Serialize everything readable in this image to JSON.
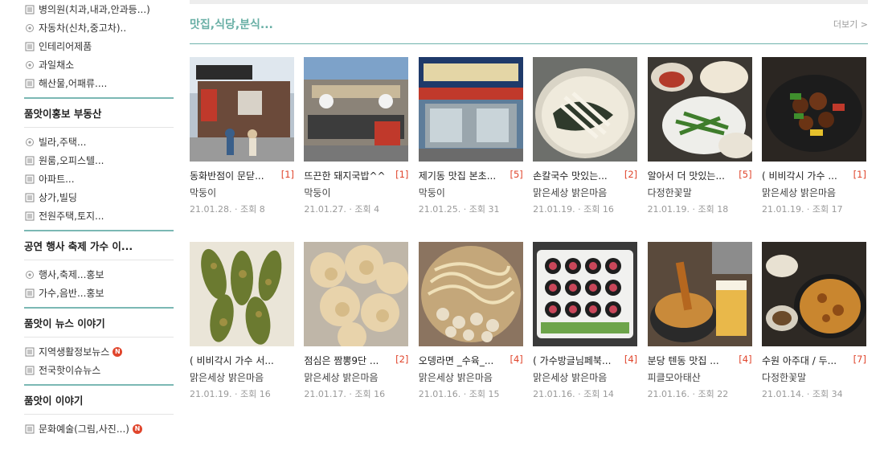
{
  "sidebar": {
    "groups": [
      {
        "title": "",
        "items": [
          {
            "icon": "board-icon",
            "label": "병의원(치과,내과,안과등...)",
            "new": false
          },
          {
            "icon": "map-icon",
            "label": "자동차(신차,중고차)..",
            "new": false
          },
          {
            "icon": "board-icon",
            "label": "인테리어제품",
            "new": false
          },
          {
            "icon": "map-icon",
            "label": "과일채소",
            "new": false
          },
          {
            "icon": "board-icon",
            "label": "해산물,어패류....",
            "new": false
          }
        ]
      },
      {
        "title": "품앗이홍보 부동산",
        "items": [
          {
            "icon": "map-icon",
            "label": "빌라,주택...",
            "new": false
          },
          {
            "icon": "board-icon",
            "label": "원룸,오피스텔...",
            "new": false
          },
          {
            "icon": "board-icon",
            "label": "아파트...",
            "new": false
          },
          {
            "icon": "board-icon",
            "label": "상가,빌딩",
            "new": false
          },
          {
            "icon": "board-icon",
            "label": "전원주택,토지...",
            "new": false
          }
        ]
      },
      {
        "title": "공연 행사 축제 가수 이...",
        "items": [
          {
            "icon": "map-icon",
            "label": "행사,축제...홍보",
            "new": false
          },
          {
            "icon": "board-icon",
            "label": "가수,음반...홍보",
            "new": false
          }
        ]
      },
      {
        "title": "품앗이 뉴스 이야기",
        "items": [
          {
            "icon": "board-icon",
            "label": "지역생활정보뉴스",
            "new": true
          },
          {
            "icon": "board-icon",
            "label": "전국핫이슈뉴스",
            "new": false
          }
        ]
      },
      {
        "title": "품앗이 이야기",
        "items": [
          {
            "icon": "board-icon",
            "label": "문화예술(그림,사진...)",
            "new": true
          }
        ]
      }
    ],
    "new_badge": "N"
  },
  "section": {
    "title": "맛집,식당,분식...",
    "more": "더보기 >"
  },
  "cards_row1": [
    {
      "title": "동화반점이 문닫...",
      "comments": "[1]",
      "author": "막둥이",
      "date": "21.01.28.",
      "views": "· 조회 8",
      "thumb": "restaurant-storefront"
    },
    {
      "title": "뜨끈한 돼지국밥^^",
      "comments": "[1]",
      "author": "막둥이",
      "date": "21.01.27.",
      "views": "· 조회 4",
      "thumb": "gukbap-shop"
    },
    {
      "title": "제기동 맛집 본초...",
      "comments": "[5]",
      "author": "막둥이",
      "date": "21.01.25.",
      "views": "· 조회 31",
      "thumb": "bonchobapsang-sign"
    },
    {
      "title": "손칼국수 맛있는...",
      "comments": "[2]",
      "author": "맑은세상 밝은마음",
      "date": "21.01.19.",
      "views": "· 조회 16",
      "thumb": "kalguksu-bowl"
    },
    {
      "title": "알아서 더 맛있는...",
      "comments": "[5]",
      "author": "다정한꽃말",
      "date": "21.01.19.",
      "views": "· 조회 18",
      "thumb": "banchan-table"
    },
    {
      "title": "( 비비각시 가수 ...",
      "comments": "[1]",
      "author": "맑은세상 밝은마음",
      "date": "21.01.19.",
      "views": "· 조회 17",
      "thumb": "stirfry-plate"
    }
  ],
  "cards_row2": [
    {
      "title": "( 비비각시 가수 서...",
      "comments": "",
      "author": "맑은세상 밝은마음",
      "date": "21.01.19.",
      "views": "· 조회 16",
      "thumb": "fried-pepper"
    },
    {
      "title": "점심은 짬뽕9단 ...",
      "comments": "[2]",
      "author": "맑은세상 밝은마음",
      "date": "21.01.17.",
      "views": "· 조회 16",
      "thumb": "tangsuyuk"
    },
    {
      "title": "오뎅라면 _수육_...",
      "comments": "[4]",
      "author": "맑은세상 밝은마음",
      "date": "21.01.16.",
      "views": "· 조회 15",
      "thumb": "odeng-ramen"
    },
    {
      "title": "( 가수방글님페북...",
      "comments": "[4]",
      "author": "맑은세상 밝은마음",
      "date": "21.01.16.",
      "views": "· 조회 14",
      "thumb": "gimbap-platter"
    },
    {
      "title": "분당 텐동 맛집 ...",
      "comments": "[4]",
      "author": "피클모아태산",
      "date": "21.01.16.",
      "views": "· 조회 22",
      "thumb": "tendon-beer"
    },
    {
      "title": "수원 아주대 / 두...",
      "comments": "[7]",
      "author": "다정한꽃말",
      "date": "21.01.14.",
      "views": "· 조회 34",
      "thumb": "pajeon-table"
    }
  ],
  "colors": {
    "accent": "#6ab0a6",
    "accent_line": "#7bb8b4",
    "comment": "#e0452c",
    "meta": "#999999"
  }
}
